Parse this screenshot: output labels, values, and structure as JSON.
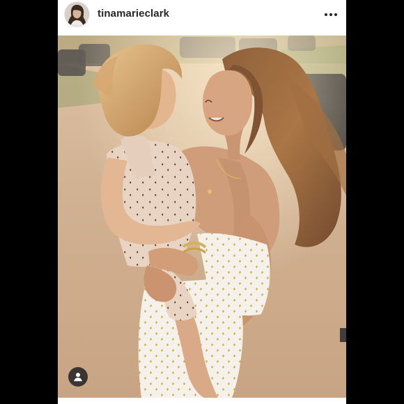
{
  "post": {
    "username": "tinamarieclark"
  },
  "icons": {
    "more": "more-horizontal-icon",
    "user_tag": "user-tag-icon",
    "avatar": "profile-avatar"
  },
  "colors": {
    "background": "#000000",
    "post_background": "#ffffff",
    "username_text": "#262626",
    "tag_button_bg": "#262626"
  }
}
